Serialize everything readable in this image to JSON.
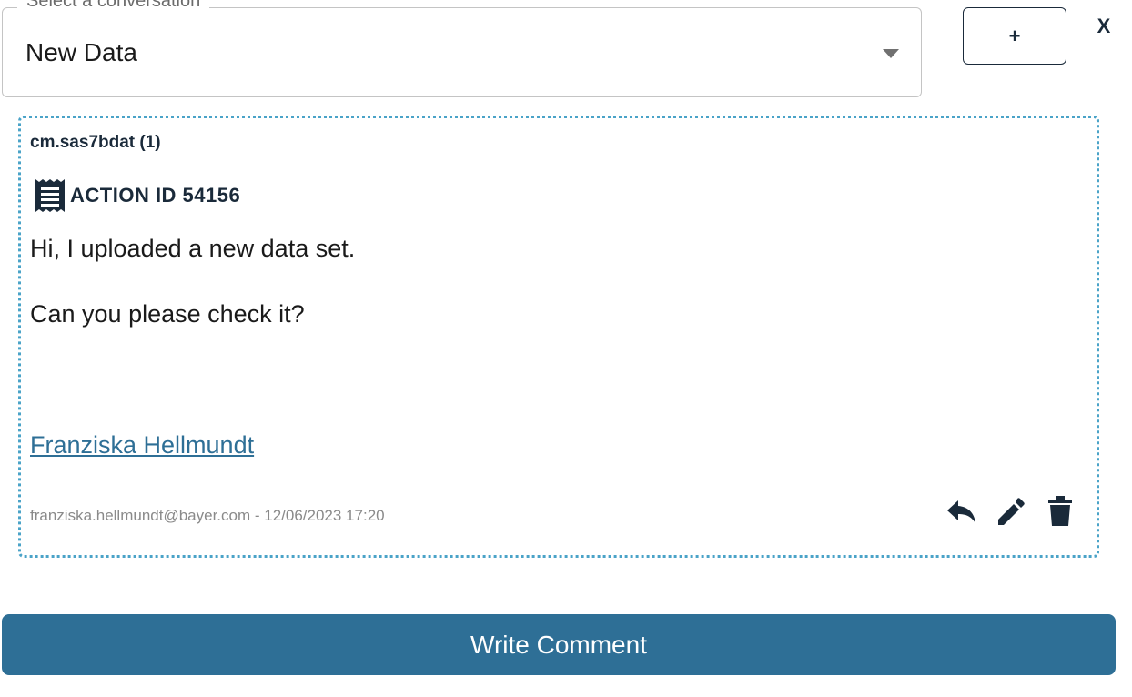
{
  "conversation_select": {
    "legend": "Select a conversation",
    "value": "New Data"
  },
  "toolbar": {
    "add_label": "+",
    "close_label": "X"
  },
  "message": {
    "file_name": "cm.sas7bdat (1)",
    "action_icon": "receipt-icon",
    "action_label": "ACTION ID 54156",
    "line_1": "Hi, I uploaded a new data set.",
    "line_2": "Can you please check it?",
    "author": "Franziska Hellmundt",
    "meta": "franziska.hellmundt@bayer.com - 12/06/2023 17:20",
    "actions": [
      "reply-icon",
      "edit-icon",
      "delete-icon"
    ]
  },
  "footer": {
    "write_comment_label": "Write Comment"
  },
  "colors": {
    "accent": "#2e6f96",
    "card_border": "#4aa3c8",
    "dark_icon": "#1a2a3a"
  }
}
